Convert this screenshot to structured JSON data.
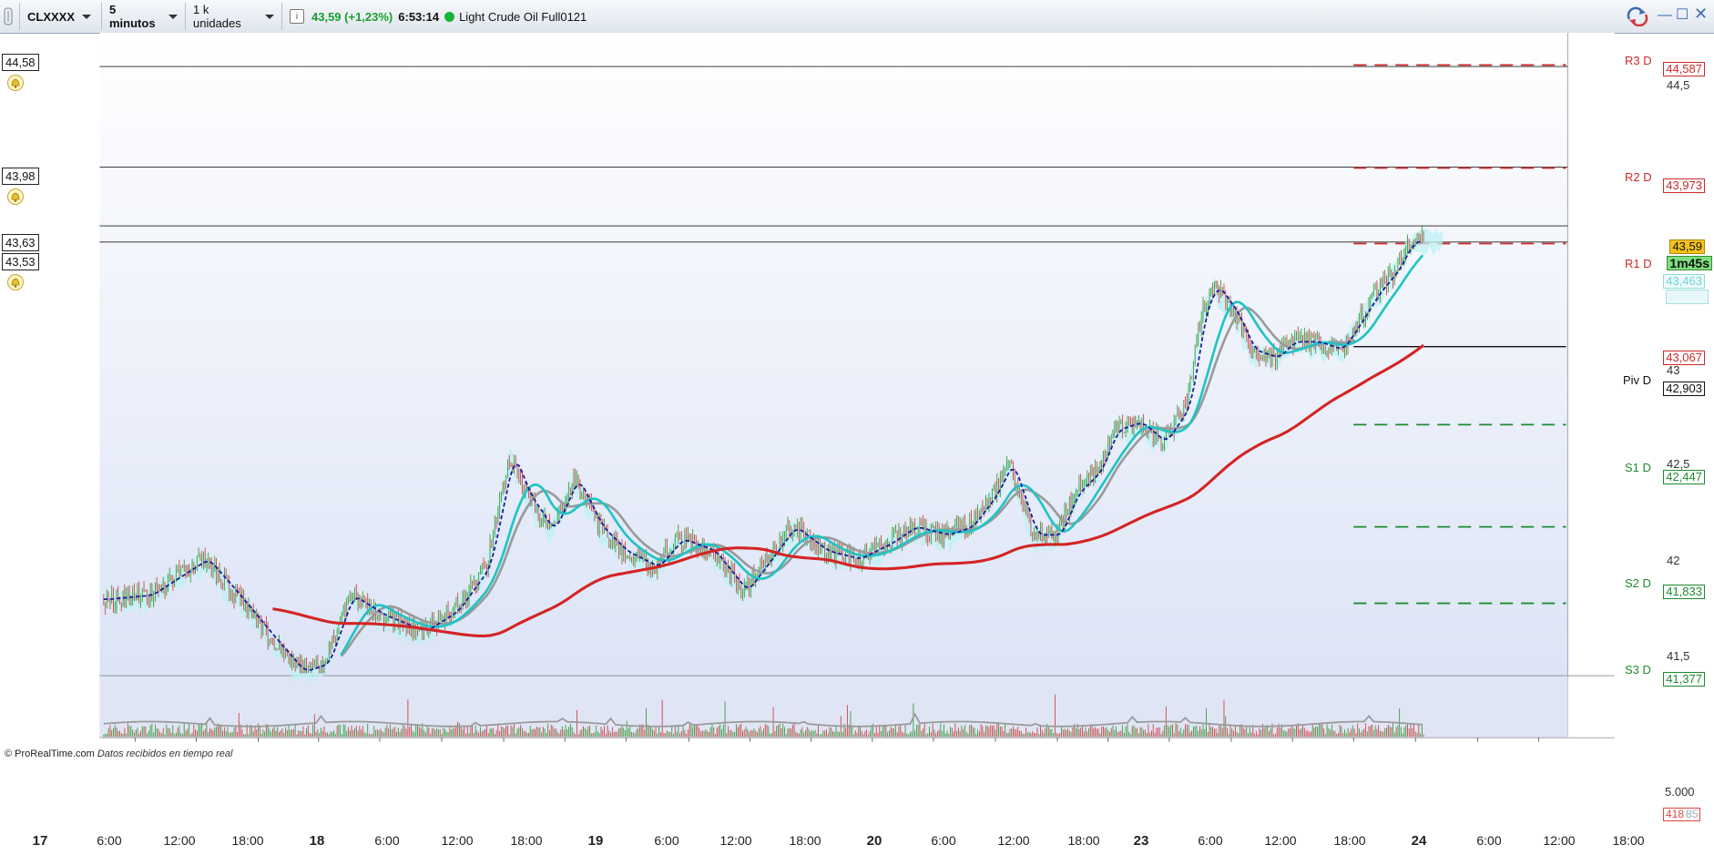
{
  "toolbar": {
    "symbol": "CLXXXX",
    "timeframe": "5 minutos",
    "units": "1 k unidades",
    "info_icon": "info-icon",
    "price_change": "43,59 (+1,23%)",
    "clock": "6:53:14",
    "status_color": "#17b33a",
    "instrument_name": "Light Crude Oil Full0121"
  },
  "price_axis": {
    "ticks": [
      "44,5",
      "43",
      "42,5",
      "42",
      "41,5"
    ]
  },
  "pivots": {
    "r3": {
      "label": "R3 D",
      "value": "44,587",
      "color": "#cc2a2a"
    },
    "r2": {
      "label": "R2 D",
      "value": "43,973",
      "color": "#cc2a2a"
    },
    "r1": {
      "label": "R1 D",
      "value": "43,59"
    },
    "piv": {
      "label": "Piv D",
      "value": "42,903",
      "color": "#111111"
    },
    "s1": {
      "label": "S1 D",
      "value": "42,447",
      "color": "#1f8b2e"
    },
    "s2": {
      "label": "S2 D",
      "value": "41,833",
      "color": "#1f8b2e"
    },
    "s3": {
      "label": "S3 D",
      "value": "41,377",
      "color": "#1f8b2e"
    }
  },
  "price_tags": {
    "last_price": "43,59",
    "countdown": "1m45s",
    "cyan_value": "43,463",
    "red_value": "43,067"
  },
  "alert_levels": [
    "44,58",
    "43,98",
    "43,63",
    "43,53"
  ],
  "time_axis": {
    "labels": [
      "17",
      "6:00",
      "12:00",
      "18:00",
      "18",
      "6:00",
      "12:00",
      "18:00",
      "19",
      "6:00",
      "12:00",
      "18:00",
      "20",
      "6:00",
      "12:00",
      "18:00",
      "23",
      "6:00",
      "12:00",
      "18:00",
      "24",
      "6:00",
      "12:00",
      "18:00"
    ],
    "bold_days": [
      "17",
      "18",
      "19",
      "20",
      "23",
      "24"
    ]
  },
  "volume": {
    "axis_label": "5.000",
    "last_value": "418",
    "ghost_value": "85"
  },
  "credit": {
    "source": "© ProRealTime.com",
    "note": "Datos recibidos en tiempo real"
  },
  "colors": {
    "accent_cyan": "#20c4c4",
    "ma_red": "#d42424",
    "ma_gray": "#9a9a9a",
    "dashed_blue": "#1a1aa0",
    "candle_green": "#3a9a3a",
    "candle_red": "#c44",
    "bg_top": "#ffffff",
    "bg_bottom": "#dfe6f7"
  }
}
